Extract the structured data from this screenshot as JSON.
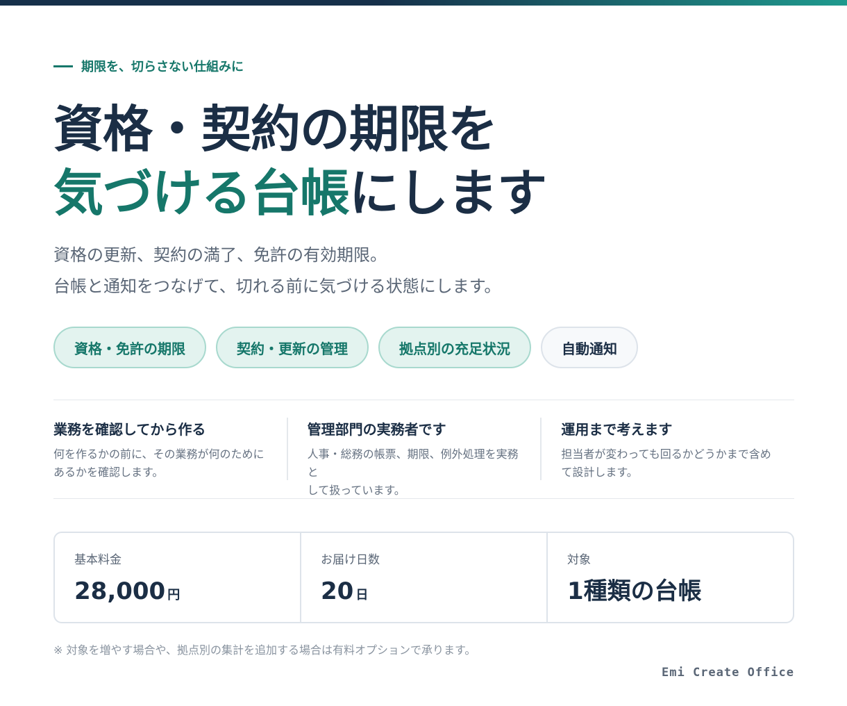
{
  "eyebrow": "期限を、切らさない仕組みに",
  "headline": {
    "line1": "資格・契約の期限を",
    "line2_accent": "気づける台帳",
    "line2_rest": "にします"
  },
  "lead": {
    "line1": "資格の更新、契約の満了、免許の有効期限。",
    "line2": "台帳と通知をつなげて、切れる前に気づける状態にします。"
  },
  "tags": [
    {
      "label": "資格・免許の期限"
    },
    {
      "label": "契約・更新の管理"
    },
    {
      "label": "拠点別の充足状況"
    },
    {
      "label": "自動通知"
    }
  ],
  "features": [
    {
      "title": "業務を確認してから作る",
      "line1": "何を作るかの前に、その業務が何のために",
      "line2": "あるかを確認します。"
    },
    {
      "title": "管理部門の実務者です",
      "line1": "人事・総務の帳票、期限、例外処理を実務と",
      "line2": "して扱っています。"
    },
    {
      "title": "運用まで考えます",
      "line1": "担当者が変わっても回るかどうかまで含め",
      "line2": "て設計します。"
    }
  ],
  "stats": [
    {
      "label": "基本料金",
      "value": "28,000",
      "unit": "円"
    },
    {
      "label": "お届け日数",
      "value": "20",
      "unit": "日"
    },
    {
      "label": "対象",
      "value": "1種類の台帳",
      "unit": ""
    }
  ],
  "note": "※ 対象を増やす場合や、拠点別の集計を追加する場合は有料オプションで承ります。",
  "brand": "Emi Create Office",
  "colors": {
    "accent": "#16776a",
    "navy": "#1b2e45",
    "tag_bg": "#e3f3ef"
  }
}
